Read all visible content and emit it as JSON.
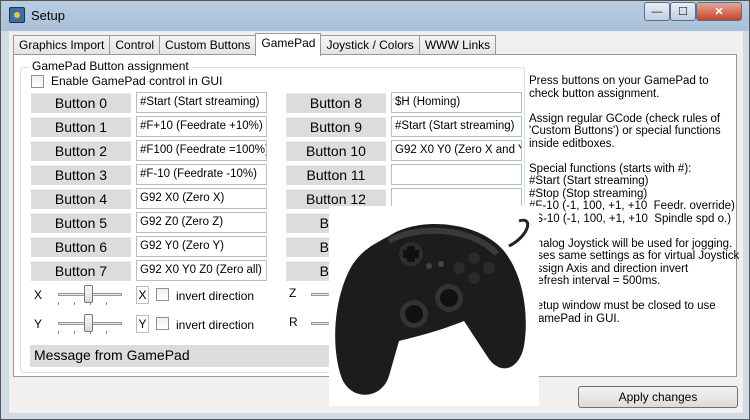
{
  "window": {
    "title": "Setup",
    "min": "—",
    "max": "☐",
    "close": "✕"
  },
  "tabs": [
    {
      "label": "Graphics Import"
    },
    {
      "label": "Control"
    },
    {
      "label": "Custom Buttons"
    },
    {
      "label": "GamePad"
    },
    {
      "label": "Joystick / Colors"
    },
    {
      "label": "WWW Links"
    }
  ],
  "active_tab": "GamePad",
  "group": {
    "title": "GamePad Button assignment",
    "enable_label": "Enable GamePad control in GUI",
    "enable_checked": false
  },
  "left_buttons": [
    {
      "label": "Button 0",
      "value": "#Start (Start streaming)"
    },
    {
      "label": "Button 1",
      "value": "#F+10 (Feedrate +10%)"
    },
    {
      "label": "Button 2",
      "value": "#F100 (Feedrate =100%)"
    },
    {
      "label": "Button 3",
      "value": "#F-10 (Feedrate -10%)"
    },
    {
      "label": "Button 4",
      "value": "G92 X0 (Zero X)"
    },
    {
      "label": "Button 5",
      "value": "G92 Z0 (Zero Z)"
    },
    {
      "label": "Button 6",
      "value": "G92 Y0 (Zero Y)"
    },
    {
      "label": "Button 7",
      "value": "G92 X0 Y0 Z0 (Zero all)"
    }
  ],
  "right_buttons": [
    {
      "label": "Button 8",
      "value": "$H (Homing)"
    },
    {
      "label": "Button 9",
      "value": "#Start (Start streaming)"
    },
    {
      "label": "Button 10",
      "value": "G92 X0 Y0 (Zero X and Y)"
    },
    {
      "label": "Button 11",
      "value": ""
    },
    {
      "label": "Button 12",
      "value": ""
    },
    {
      "label": "Butto",
      "value": ""
    },
    {
      "label": "Butto",
      "value": ""
    },
    {
      "label": "Butto",
      "value": ""
    }
  ],
  "axes": [
    {
      "axis": "X",
      "assign": "X",
      "invert_label": "invert direction"
    },
    {
      "axis": "Y",
      "assign": "Y",
      "invert_label": "invert direction"
    },
    {
      "axis": "Z"
    },
    {
      "axis": "R"
    }
  ],
  "message_label": "Message from GamePad",
  "info_text": "Press buttons on your GamePad to\ncheck button assignment.\n\nAssign regular GCode (check rules of\n'Custom Buttons') or special functions\ninside editboxes.\n\nSpecial functions (starts with #):\n#Start (Start streaming)\n#Stop (Stop streaming)\n#F-10 (-1, 100, +1, +10  Feedr. override)\n#S-10 (-1, 100, +1, +10  Spindle spd o.)\n\nAnalog Joystick will be used for jogging.\nUses same settings as for virtual Joystick\nAssign Axis and direction invert\nRefresh interval = 500ms.\n\nSetup window must be closed to use\nGamePad in GUI.",
  "apply_label": "Apply changes"
}
